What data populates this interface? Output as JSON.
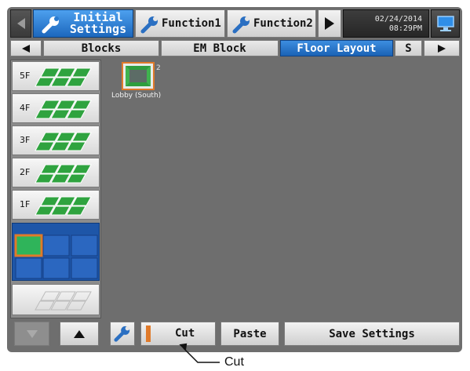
{
  "header": {
    "tabs": [
      {
        "label_line1": "Initial",
        "label_line2": "Settings"
      },
      {
        "label": "Function1"
      },
      {
        "label": "Function2"
      }
    ],
    "date": "02/24/2014",
    "time": "08:29PM"
  },
  "subtabs": [
    {
      "label": "Blocks"
    },
    {
      "label": "EM Block"
    },
    {
      "label": "Floor Layout"
    },
    {
      "label": "S"
    }
  ],
  "floors": [
    {
      "label": "5F"
    },
    {
      "label": "4F"
    },
    {
      "label": "3F"
    },
    {
      "label": "2F"
    },
    {
      "label": "1F"
    }
  ],
  "unit": {
    "name": "Lobby (South)",
    "number": "2"
  },
  "toolbar": {
    "cut_label": "Cut",
    "paste_label": "Paste",
    "save_label": "Save Settings"
  },
  "callout": {
    "label": "Cut"
  },
  "colors": {
    "accent": "#1a62b5",
    "panel": "#6e6e6e",
    "tile": "#2e9e3e",
    "highlight": "#e07a2a"
  }
}
